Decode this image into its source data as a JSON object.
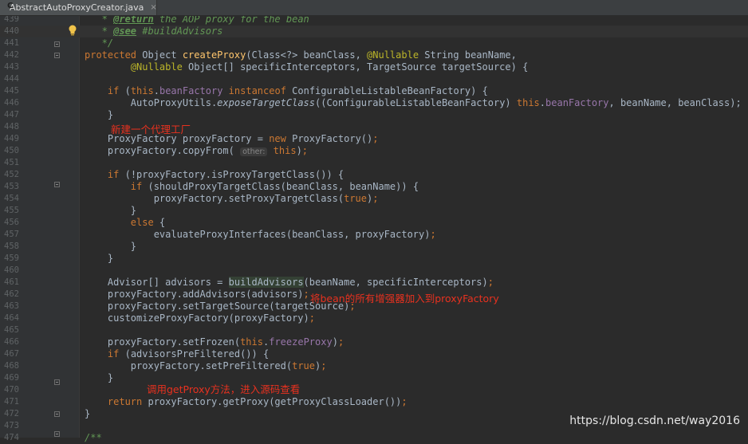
{
  "tab": {
    "filename": "AbstractAutoProxyCreator.java",
    "close": "×"
  },
  "notes": {
    "note1": "新建一个代理工厂",
    "note2": "将bean的所有增强器加入到proxyFactory",
    "note3": "调用getProxy方法，进入源码查看"
  },
  "watermark": "https://blog.csdn.net/way2016",
  "lines": [
    {
      "n": "439",
      "segs": [
        [
          "cm",
          "   * "
        ],
        [
          "cmtag",
          "@return"
        ],
        [
          "cm",
          " the AOP proxy for the bean"
        ]
      ]
    },
    {
      "n": "440",
      "segs": [
        [
          "cm",
          "   * "
        ],
        [
          "cmtag",
          "@see"
        ],
        [
          "cm",
          " #buildAdvisors"
        ]
      ]
    },
    {
      "n": "441",
      "segs": [
        [
          "cm",
          "   */"
        ]
      ]
    },
    {
      "n": "442",
      "segs": [
        [
          "kw",
          "protected "
        ],
        [
          "",
          "Object "
        ],
        [
          "fn",
          "createProxy"
        ],
        [
          "",
          "(Class<?> beanClass, "
        ],
        [
          "ann",
          "@Nullable "
        ],
        [
          "",
          "String beanName,"
        ]
      ]
    },
    {
      "n": "443",
      "segs": [
        [
          "",
          "        "
        ],
        [
          "ann",
          "@Nullable "
        ],
        [
          "",
          "Object[] specificInterceptors, TargetSource targetSource) {"
        ]
      ]
    },
    {
      "n": "444",
      "segs": []
    },
    {
      "n": "445",
      "segs": [
        [
          "",
          "    "
        ],
        [
          "kw",
          "if "
        ],
        [
          "",
          "("
        ],
        [
          "kw",
          "this"
        ],
        [
          "",
          "."
        ],
        [
          "fld",
          "beanFactory "
        ],
        [
          "kw",
          "instanceof "
        ],
        [
          "",
          "ConfigurableListableBeanFactory) {"
        ]
      ]
    },
    {
      "n": "446",
      "segs": [
        [
          "",
          "        AutoProxyUtils."
        ],
        [
          "it",
          "exposeTargetClass"
        ],
        [
          "",
          "((ConfigurableListableBeanFactory) "
        ],
        [
          "kw",
          "this"
        ],
        [
          "",
          "."
        ],
        [
          "fld",
          "beanFactory"
        ],
        [
          "",
          ", beanName, beanClass);"
        ]
      ]
    },
    {
      "n": "447",
      "segs": [
        [
          "",
          "    }"
        ]
      ]
    },
    {
      "n": "448",
      "segs": []
    },
    {
      "n": "449",
      "segs": [
        [
          "",
          "    ProxyFactory proxyFactory = "
        ],
        [
          "kw",
          "new "
        ],
        [
          "",
          "ProxyFactory()"
        ],
        [
          "kw",
          ";"
        ]
      ]
    },
    {
      "n": "450",
      "segs": [
        [
          "",
          "    proxyFactory.copyFrom( "
        ],
        [
          "hint",
          "other:"
        ],
        [
          "",
          " "
        ],
        [
          "kw",
          "this"
        ],
        [
          "",
          ")"
        ],
        [
          "kw",
          ";"
        ]
      ]
    },
    {
      "n": "451",
      "segs": []
    },
    {
      "n": "452",
      "segs": [
        [
          "",
          "    "
        ],
        [
          "kw",
          "if "
        ],
        [
          "",
          "(!proxyFactory.isProxyTargetClass()) {"
        ]
      ]
    },
    {
      "n": "453",
      "segs": [
        [
          "",
          "        "
        ],
        [
          "kw",
          "if "
        ],
        [
          "",
          "(shouldProxyTargetClass(beanClass, beanName)) {"
        ]
      ]
    },
    {
      "n": "454",
      "segs": [
        [
          "",
          "            proxyFactory.setProxyTargetClass("
        ],
        [
          "kw",
          "true"
        ],
        [
          "",
          ")"
        ],
        [
          "kw",
          ";"
        ]
      ]
    },
    {
      "n": "455",
      "segs": [
        [
          "",
          "        }"
        ]
      ]
    },
    {
      "n": "456",
      "segs": [
        [
          "",
          "        "
        ],
        [
          "kw",
          "else "
        ],
        [
          "",
          "{"
        ]
      ]
    },
    {
      "n": "457",
      "segs": [
        [
          "",
          "            evaluateProxyInterfaces(beanClass, proxyFactory)"
        ],
        [
          "kw",
          ";"
        ]
      ]
    },
    {
      "n": "458",
      "segs": [
        [
          "",
          "        }"
        ]
      ]
    },
    {
      "n": "459",
      "segs": [
        [
          "",
          "    }"
        ]
      ]
    },
    {
      "n": "460",
      "segs": []
    },
    {
      "n": "461",
      "segs": [
        [
          "",
          "    Advisor[] advisors = "
        ],
        [
          "hl",
          "buildAdvisors"
        ],
        [
          "",
          "(beanName, specificInterceptors)"
        ],
        [
          "kw",
          ";"
        ]
      ]
    },
    {
      "n": "462",
      "segs": [
        [
          "",
          "    proxyFactory.addAdvisors(advisors)"
        ],
        [
          "kw",
          ";"
        ]
      ]
    },
    {
      "n": "463",
      "segs": [
        [
          "",
          "    proxyFactory.setTargetSource(targetSource)"
        ],
        [
          "kw",
          ";"
        ]
      ]
    },
    {
      "n": "464",
      "segs": [
        [
          "",
          "    customizeProxyFactory(proxyFactory)"
        ],
        [
          "kw",
          ";"
        ]
      ]
    },
    {
      "n": "465",
      "segs": []
    },
    {
      "n": "466",
      "segs": [
        [
          "",
          "    proxyFactory.setFrozen("
        ],
        [
          "kw",
          "this"
        ],
        [
          "",
          "."
        ],
        [
          "fld",
          "freezeProxy"
        ],
        [
          "",
          ")"
        ],
        [
          "kw",
          ";"
        ]
      ]
    },
    {
      "n": "467",
      "segs": [
        [
          "",
          "    "
        ],
        [
          "kw",
          "if "
        ],
        [
          "",
          "(advisorsPreFiltered()) {"
        ]
      ]
    },
    {
      "n": "468",
      "segs": [
        [
          "",
          "        proxyFactory.setPreFiltered("
        ],
        [
          "kw",
          "true"
        ],
        [
          "",
          ")"
        ],
        [
          "kw",
          ";"
        ]
      ]
    },
    {
      "n": "469",
      "segs": [
        [
          "",
          "    }"
        ]
      ]
    },
    {
      "n": "470",
      "segs": []
    },
    {
      "n": "471",
      "segs": [
        [
          "",
          "    "
        ],
        [
          "kw",
          "return "
        ],
        [
          "",
          "proxyFactory.getProxy(getProxyClassLoader())"
        ],
        [
          "kw",
          ";"
        ]
      ]
    },
    {
      "n": "472",
      "segs": [
        [
          "",
          "}"
        ]
      ]
    },
    {
      "n": "473",
      "segs": []
    },
    {
      "n": "474",
      "segs": [
        [
          "cm",
          "/**"
        ]
      ]
    }
  ]
}
